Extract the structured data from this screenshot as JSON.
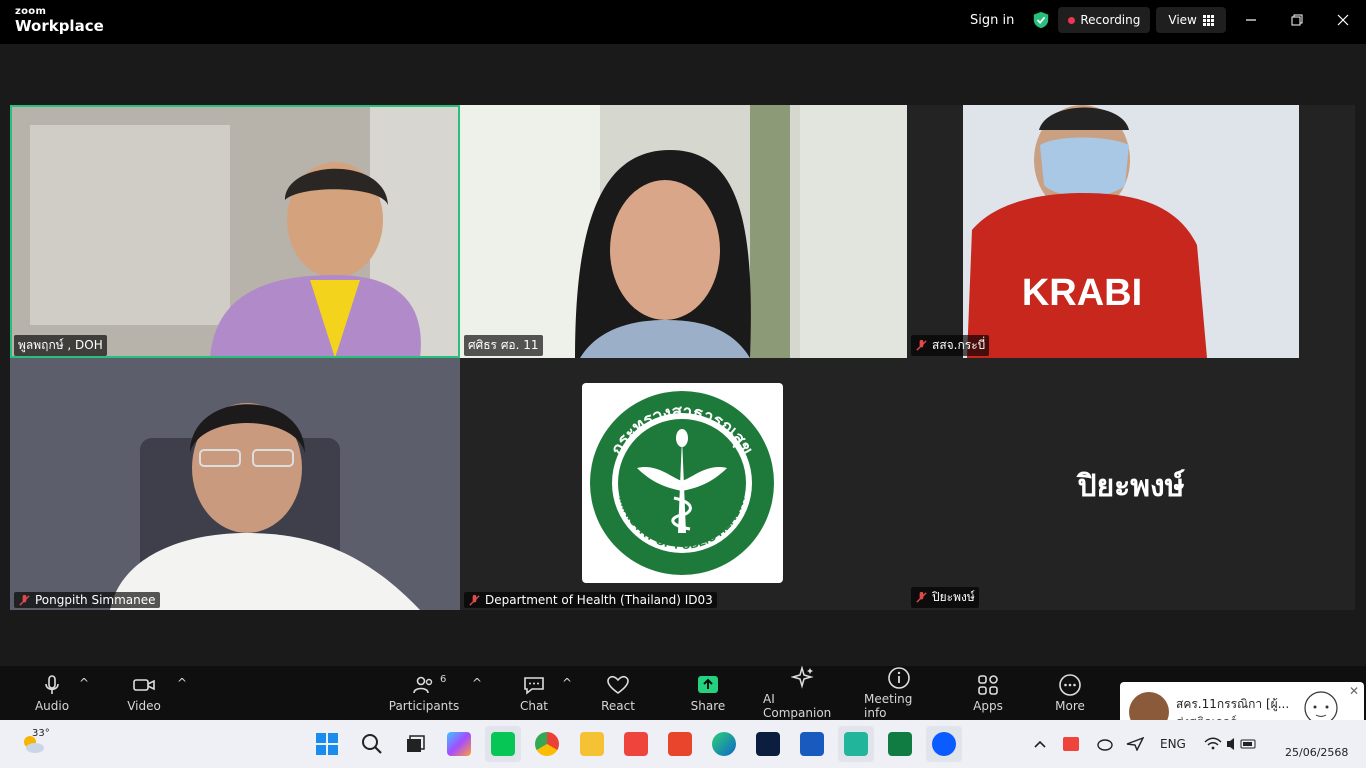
{
  "app": {
    "brand_small": "zoom",
    "brand_large": "Workplace"
  },
  "topbar": {
    "sign_in": "Sign in",
    "recording": "Recording",
    "view": "View"
  },
  "participants": [
    {
      "name": "พูลพฤกษ์ , DOH"
    },
    {
      "name": "ศศิธร ศอ. 11"
    },
    {
      "name": "สสจ.กระบี่"
    },
    {
      "name": "Pongpith Simmanee"
    },
    {
      "name": "Department of Health (Thailand) ID03",
      "logo_text": "กระทรวงสาธารณสุข",
      "logo_sub": "MINISTRY OF PUBLIC HEALTH"
    },
    {
      "name": "ปิยะพงษ์",
      "placeholder": "ปิยะพงษ์"
    }
  ],
  "shirt_text": "KRABI",
  "toolbar": {
    "audio": "Audio",
    "video": "Video",
    "participants": "Participants",
    "participants_count": "6",
    "chat": "Chat",
    "react": "React",
    "share": "Share",
    "ai": "AI Companion",
    "meeting_info": "Meeting info",
    "apps": "Apps",
    "more": "More"
  },
  "notification": {
    "title": "สคร.11กรรณิกา [ผู้...",
    "body": "ส่งสติกเกอร์"
  },
  "taskbar": {
    "temp": "33°",
    "lang": "ENG",
    "date": "25/06/2568"
  },
  "colors": {
    "active_border": "#27c07c",
    "share_green": "#23d17e",
    "record_red": "#f0354f",
    "muted_red": "#e04a4a"
  }
}
